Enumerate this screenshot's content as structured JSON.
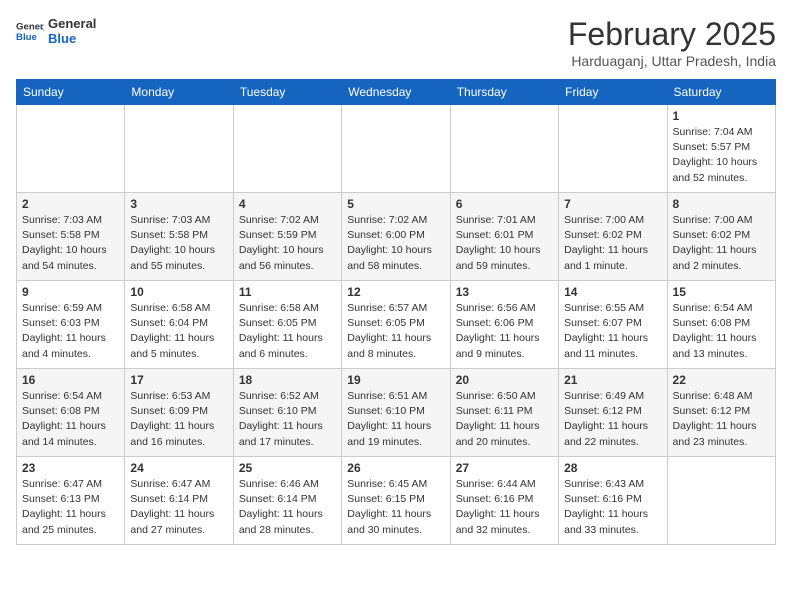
{
  "header": {
    "logo_general": "General",
    "logo_blue": "Blue",
    "month_year": "February 2025",
    "location": "Harduaganj, Uttar Pradesh, India"
  },
  "days_of_week": [
    "Sunday",
    "Monday",
    "Tuesday",
    "Wednesday",
    "Thursday",
    "Friday",
    "Saturday"
  ],
  "weeks": [
    [
      {
        "day": "",
        "info": ""
      },
      {
        "day": "",
        "info": ""
      },
      {
        "day": "",
        "info": ""
      },
      {
        "day": "",
        "info": ""
      },
      {
        "day": "",
        "info": ""
      },
      {
        "day": "",
        "info": ""
      },
      {
        "day": "1",
        "info": "Sunrise: 7:04 AM\nSunset: 5:57 PM\nDaylight: 10 hours\nand 52 minutes."
      }
    ],
    [
      {
        "day": "2",
        "info": "Sunrise: 7:03 AM\nSunset: 5:58 PM\nDaylight: 10 hours\nand 54 minutes."
      },
      {
        "day": "3",
        "info": "Sunrise: 7:03 AM\nSunset: 5:58 PM\nDaylight: 10 hours\nand 55 minutes."
      },
      {
        "day": "4",
        "info": "Sunrise: 7:02 AM\nSunset: 5:59 PM\nDaylight: 10 hours\nand 56 minutes."
      },
      {
        "day": "5",
        "info": "Sunrise: 7:02 AM\nSunset: 6:00 PM\nDaylight: 10 hours\nand 58 minutes."
      },
      {
        "day": "6",
        "info": "Sunrise: 7:01 AM\nSunset: 6:01 PM\nDaylight: 10 hours\nand 59 minutes."
      },
      {
        "day": "7",
        "info": "Sunrise: 7:00 AM\nSunset: 6:02 PM\nDaylight: 11 hours\nand 1 minute."
      },
      {
        "day": "8",
        "info": "Sunrise: 7:00 AM\nSunset: 6:02 PM\nDaylight: 11 hours\nand 2 minutes."
      }
    ],
    [
      {
        "day": "9",
        "info": "Sunrise: 6:59 AM\nSunset: 6:03 PM\nDaylight: 11 hours\nand 4 minutes."
      },
      {
        "day": "10",
        "info": "Sunrise: 6:58 AM\nSunset: 6:04 PM\nDaylight: 11 hours\nand 5 minutes."
      },
      {
        "day": "11",
        "info": "Sunrise: 6:58 AM\nSunset: 6:05 PM\nDaylight: 11 hours\nand 6 minutes."
      },
      {
        "day": "12",
        "info": "Sunrise: 6:57 AM\nSunset: 6:05 PM\nDaylight: 11 hours\nand 8 minutes."
      },
      {
        "day": "13",
        "info": "Sunrise: 6:56 AM\nSunset: 6:06 PM\nDaylight: 11 hours\nand 9 minutes."
      },
      {
        "day": "14",
        "info": "Sunrise: 6:55 AM\nSunset: 6:07 PM\nDaylight: 11 hours\nand 11 minutes."
      },
      {
        "day": "15",
        "info": "Sunrise: 6:54 AM\nSunset: 6:08 PM\nDaylight: 11 hours\nand 13 minutes."
      }
    ],
    [
      {
        "day": "16",
        "info": "Sunrise: 6:54 AM\nSunset: 6:08 PM\nDaylight: 11 hours\nand 14 minutes."
      },
      {
        "day": "17",
        "info": "Sunrise: 6:53 AM\nSunset: 6:09 PM\nDaylight: 11 hours\nand 16 minutes."
      },
      {
        "day": "18",
        "info": "Sunrise: 6:52 AM\nSunset: 6:10 PM\nDaylight: 11 hours\nand 17 minutes."
      },
      {
        "day": "19",
        "info": "Sunrise: 6:51 AM\nSunset: 6:10 PM\nDaylight: 11 hours\nand 19 minutes."
      },
      {
        "day": "20",
        "info": "Sunrise: 6:50 AM\nSunset: 6:11 PM\nDaylight: 11 hours\nand 20 minutes."
      },
      {
        "day": "21",
        "info": "Sunrise: 6:49 AM\nSunset: 6:12 PM\nDaylight: 11 hours\nand 22 minutes."
      },
      {
        "day": "22",
        "info": "Sunrise: 6:48 AM\nSunset: 6:12 PM\nDaylight: 11 hours\nand 23 minutes."
      }
    ],
    [
      {
        "day": "23",
        "info": "Sunrise: 6:47 AM\nSunset: 6:13 PM\nDaylight: 11 hours\nand 25 minutes."
      },
      {
        "day": "24",
        "info": "Sunrise: 6:47 AM\nSunset: 6:14 PM\nDaylight: 11 hours\nand 27 minutes."
      },
      {
        "day": "25",
        "info": "Sunrise: 6:46 AM\nSunset: 6:14 PM\nDaylight: 11 hours\nand 28 minutes."
      },
      {
        "day": "26",
        "info": "Sunrise: 6:45 AM\nSunset: 6:15 PM\nDaylight: 11 hours\nand 30 minutes."
      },
      {
        "day": "27",
        "info": "Sunrise: 6:44 AM\nSunset: 6:16 PM\nDaylight: 11 hours\nand 32 minutes."
      },
      {
        "day": "28",
        "info": "Sunrise: 6:43 AM\nSunset: 6:16 PM\nDaylight: 11 hours\nand 33 minutes."
      },
      {
        "day": "",
        "info": ""
      }
    ]
  ]
}
